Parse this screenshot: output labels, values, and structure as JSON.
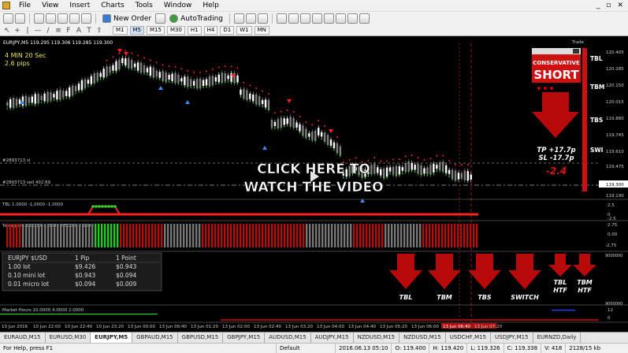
{
  "menu": {
    "items": [
      "File",
      "View",
      "Insert",
      "Charts",
      "Tools",
      "Window",
      "Help"
    ],
    "controls": [
      "_",
      "▫",
      "✕"
    ]
  },
  "toolbar": {
    "new_order_label": "New Order",
    "autotrading_label": "AutoTrading"
  },
  "timeframes": [
    "M1",
    "M5",
    "M15",
    "M30",
    "H1",
    "H4",
    "D1",
    "W1",
    "MN"
  ],
  "active_timeframe": "M5",
  "chart": {
    "header": "EURJPY,M5   119.295 119.306 119.285 119.300",
    "timer": "4 MIN 20 Sec",
    "spread": "2.6 pips",
    "order_label_sl": "#2893713 sl",
    "order_label_sell": "#2893713 sell 402.69",
    "price_ticks": [
      "120.405",
      "120.285",
      "120.150",
      "120.015",
      "119.880",
      "119.745",
      "119.610",
      "119.475",
      "119.300",
      "119.190"
    ],
    "current_price": "119.300",
    "time_ticks": [
      "10 Jun 2016",
      "10 Jun 22:00",
      "10 Jun 22:40",
      "10 Jun 23:20",
      "13 Jun 00:00",
      "13 Jun 00:40",
      "13 Jun 01:20",
      "13 Jun 02:00",
      "13 Jun 02:40",
      "13 Jun 03:20",
      "13 Jun 04:00",
      "13 Jun 04:40",
      "13 Jun 05:20",
      "13 Jun 06:00",
      "13 Jun 06:40",
      "13 Jun 07:20"
    ],
    "video_overlay": [
      "CLICK HERE TO",
      "WATCH THE VIDEO"
    ]
  },
  "trade_panel": {
    "title": "Trade",
    "mode": "CONSERVATIVE",
    "direction": "SHORT",
    "levels": [
      "TBL",
      "TBM",
      "TBS",
      "SWI"
    ],
    "tp": "TP +17.7p",
    "sl": "SL  -17.7p",
    "result": "-2.4"
  },
  "tbl_indicator": {
    "label": "TBL 1.0000 -1.0000 -1.0000",
    "ticks": [
      "2.5",
      "0",
      "-2.5"
    ]
  },
  "tetragram_indicator": {
    "label": "Tetragram 1.0000 -1.0000 2.5000 -2.5000",
    "ticks": [
      "2.75",
      "0.00",
      "-2.75"
    ]
  },
  "pip_calculator": {
    "header": [
      "EURJPY $USD",
      "1 Pip",
      "1 Point"
    ],
    "rows": [
      [
        "1.00 lot",
        "$9.426",
        "$0.943"
      ],
      [
        "0.10 mini lot",
        "$0.943",
        "$0.094"
      ],
      [
        "0.01 micro lot",
        "$0.094",
        "$0.009"
      ]
    ]
  },
  "signal_panel": {
    "arrows": [
      {
        "label_top": "TBL",
        "label_bottom": ""
      },
      {
        "label_top": "TBM",
        "label_bottom": ""
      },
      {
        "label_top": "TBS",
        "label_bottom": ""
      },
      {
        "label_top": "SWITCH",
        "label_bottom": ""
      },
      {
        "label_top": "TBL",
        "label_bottom": "HTF"
      },
      {
        "label_top": "TBM",
        "label_bottom": "HTF"
      }
    ],
    "ticks": [
      "9000000",
      "9000000"
    ]
  },
  "market_hours": {
    "label": "Market Hours 10.0000 4.0000 2.0000",
    "ticks": [
      "12",
      "0"
    ]
  },
  "symbol_tabs": [
    "EURAUD,M15",
    "EURUSD,M30",
    "EURJPY,M5",
    "GBPAUD,M15",
    "GBPUSD,M15",
    "GBPJPY,M15",
    "AUDUSD,M15",
    "AUDJPY,M15",
    "NZDUSD,M15",
    "NZDUSD,M15",
    "USDCHF,M15",
    "USDJPY,M15",
    "EURNZD,Daily"
  ],
  "active_symbol_tab": "EURJPY,M5",
  "status": {
    "help": "For Help, press F1",
    "profile": "Default",
    "datetime": "2016.06.13 05:10",
    "open": "O: 119.400",
    "high": "H: 119.420",
    "low": "L: 119.326",
    "close": "C: 119.338",
    "volume": "V: 418",
    "traffic": "2128/15 kb"
  },
  "colors": {
    "bull_candle": "#ffffff",
    "bear_candle": "#808080",
    "buy_arrow": "#3a8bff",
    "sell_arrow": "#ff2020",
    "signal_red": "#e01010",
    "accent_green": "#22cc22"
  }
}
